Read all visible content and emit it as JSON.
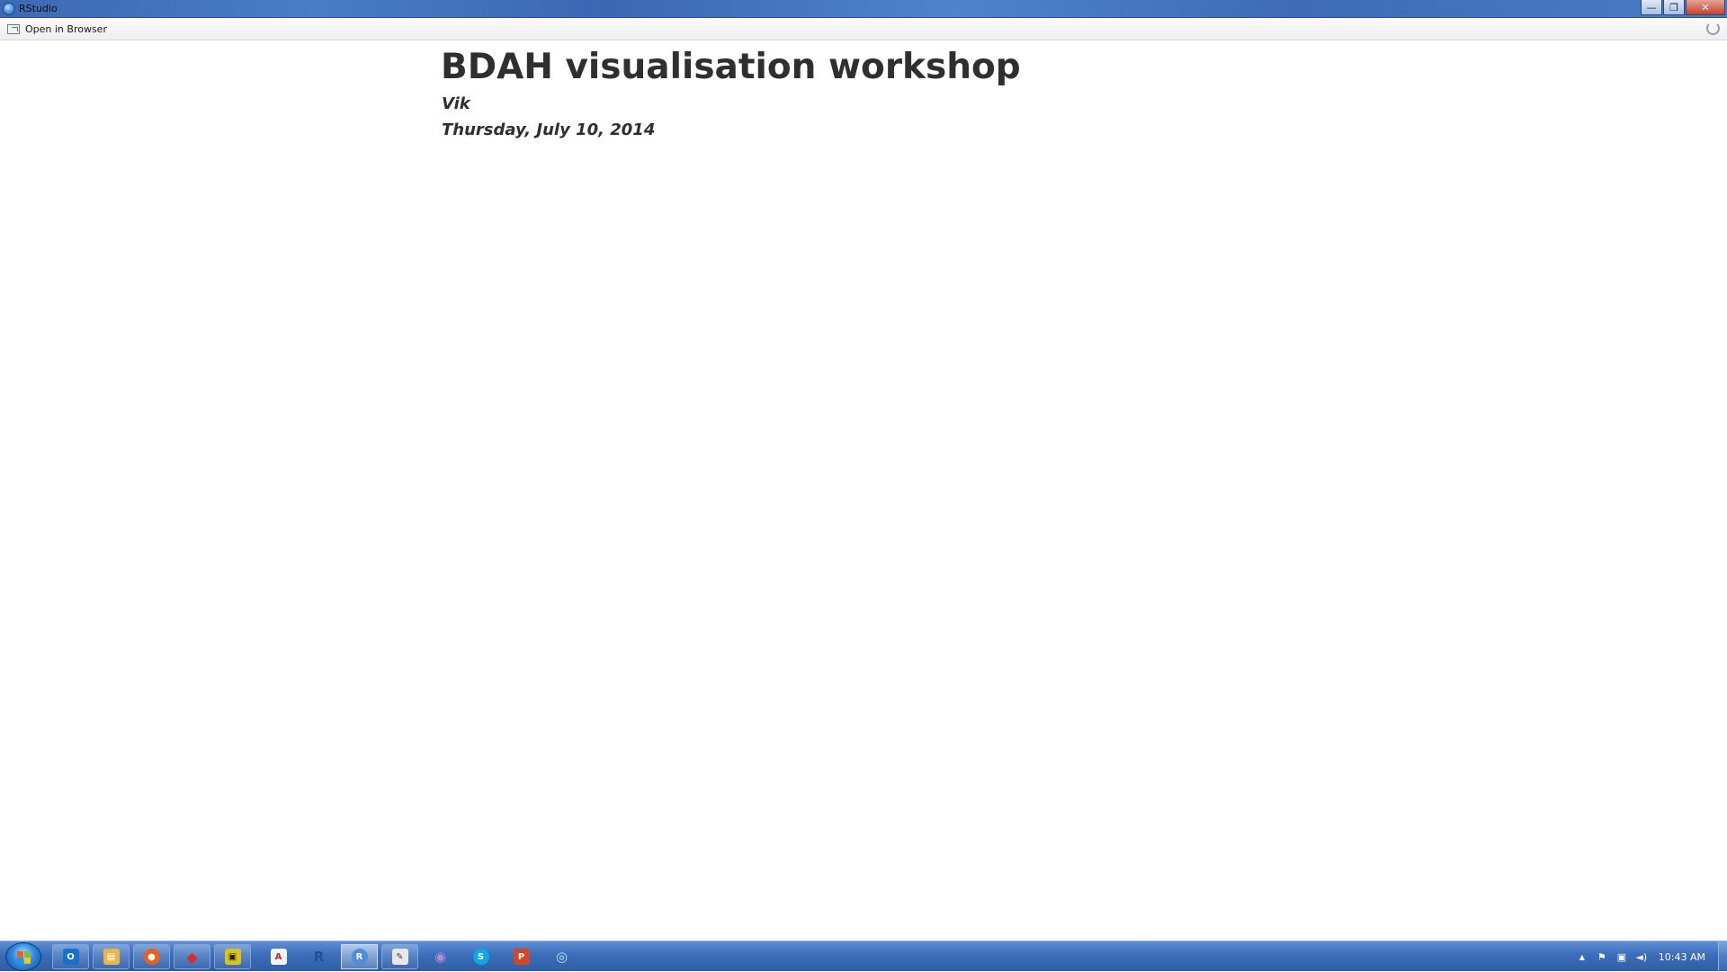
{
  "window": {
    "title": "RStudio",
    "controls": {
      "minimize": "—",
      "restore": "❐",
      "close": "✕"
    }
  },
  "toolbar": {
    "open_in_browser_label": "Open in Browser",
    "refresh_icon": "refresh-icon"
  },
  "document": {
    "title": "BDAH visualisation workshop",
    "author": "Vik",
    "date": "Thursday, July 10, 2014"
  },
  "taskbar": {
    "apps": [
      {
        "name": "outlook",
        "glyph": "O",
        "color": "#1a6fc9"
      },
      {
        "name": "file-explorer",
        "glyph": "▤",
        "color": "#e6b84a"
      },
      {
        "name": "firefox",
        "glyph": "●",
        "color": "#e5621d"
      },
      {
        "name": "app-red",
        "glyph": "◆",
        "color": "#d92b2b"
      },
      {
        "name": "app-yellow",
        "glyph": "▣",
        "color": "#d8c51b"
      },
      {
        "name": "adobe-reader",
        "glyph": "A",
        "color": "#c8271f"
      },
      {
        "name": "r",
        "glyph": "R",
        "color": "#2d6fc0"
      },
      {
        "name": "rstudio",
        "glyph": "R",
        "color": "#4a8fd8"
      },
      {
        "name": "app-tools",
        "glyph": "✎",
        "color": "#3f3f3f"
      },
      {
        "name": "app-globe",
        "glyph": "◉",
        "color": "#8b3fa8"
      },
      {
        "name": "skype",
        "glyph": "S",
        "color": "#10a7e6"
      },
      {
        "name": "powerpoint",
        "glyph": "P",
        "color": "#d24726"
      },
      {
        "name": "app-blue",
        "glyph": "◎",
        "color": "#2c8ad1"
      }
    ],
    "tray": {
      "show_hidden": "▲",
      "flag": "⚑",
      "network": "▣",
      "volume": "◄)",
      "clock": "10:43 AM"
    }
  }
}
